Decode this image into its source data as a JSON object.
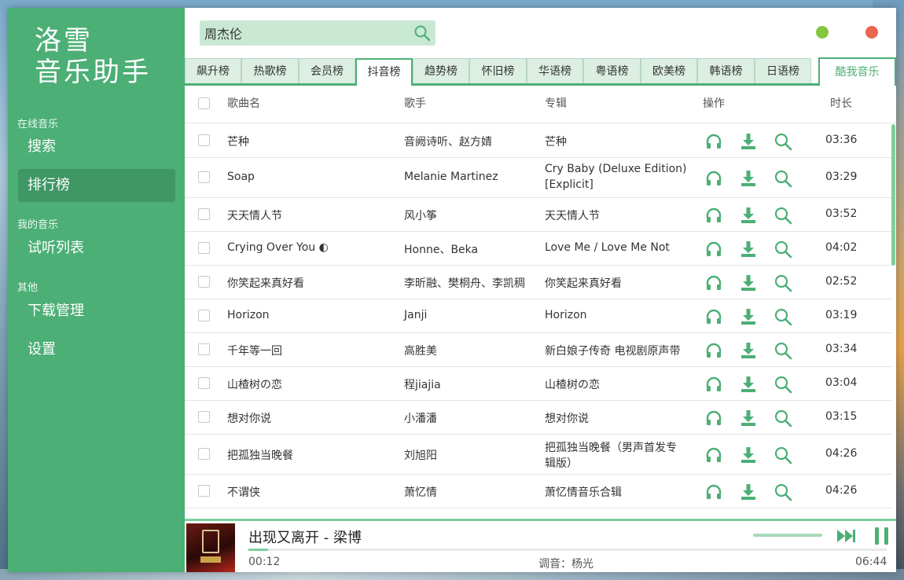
{
  "app": {
    "logo_line1": "洛雪",
    "logo_line2": "音乐助手"
  },
  "sidebar": {
    "sections": [
      {
        "label": "在线音乐",
        "items": [
          {
            "label": "搜索"
          },
          {
            "label": "排行榜",
            "active": true
          }
        ]
      },
      {
        "label": "我的音乐",
        "items": [
          {
            "label": "试听列表"
          }
        ]
      },
      {
        "label": "其他",
        "items": [
          {
            "label": "下载管理"
          },
          {
            "label": "设置"
          }
        ]
      }
    ]
  },
  "search": {
    "value": "周杰伦",
    "icon": "search-icon"
  },
  "window_controls": {
    "minimize_color": "#85c63f",
    "close_color": "#e9674f"
  },
  "tabs": [
    {
      "label": "飙升榜"
    },
    {
      "label": "热歌榜"
    },
    {
      "label": "会员榜"
    },
    {
      "label": "抖音榜",
      "active": true
    },
    {
      "label": "趋势榜"
    },
    {
      "label": "怀旧榜"
    },
    {
      "label": "华语榜"
    },
    {
      "label": "粤语榜"
    },
    {
      "label": "欧美榜"
    },
    {
      "label": "韩语榜"
    },
    {
      "label": "日语榜"
    }
  ],
  "source_tab": {
    "label": "酷我音乐"
  },
  "table": {
    "headers": {
      "name": "歌曲名",
      "artist": "歌手",
      "album": "专辑",
      "ops": "操作",
      "duration": "时长"
    },
    "rows": [
      {
        "name": "芒种",
        "artist": "音阙诗听、赵方婧",
        "album": "芒种",
        "album2": "",
        "duration": "03:36"
      },
      {
        "name": "Soap",
        "artist": "Melanie Martinez",
        "album": "Cry Baby (Deluxe Edition)",
        "album2": "[Explicit]",
        "duration": "03:29"
      },
      {
        "name": "天天情人节",
        "artist": "风小筝",
        "album": "天天情人节",
        "album2": "",
        "duration": "03:52"
      },
      {
        "name": "Crying Over You ◐",
        "artist": "Honne、Beka",
        "album": "Love Me / Love Me Not",
        "album2": "",
        "duration": "04:02"
      },
      {
        "name": "你笑起来真好看",
        "artist": "李昕融、樊桐舟、李凯稠",
        "album": "你笑起来真好看",
        "album2": "",
        "duration": "02:52"
      },
      {
        "name": "Horizon",
        "artist": "Janji",
        "album": "Horizon",
        "album2": "",
        "duration": "03:19"
      },
      {
        "name": "千年等一回",
        "artist": "高胜美",
        "album": "新白娘子传奇 电视剧原声带",
        "album2": "",
        "duration": "03:34"
      },
      {
        "name": "山楂树の恋",
        "artist": "程jiajia",
        "album": "山楂树の恋",
        "album2": "",
        "duration": "03:04"
      },
      {
        "name": "想对你说",
        "artist": "小潘潘",
        "album": "想对你说",
        "album2": "",
        "duration": "03:15"
      },
      {
        "name": "把孤独当晚餐",
        "artist": "刘旭阳",
        "album": "把孤独当晚餐（男声首发专",
        "album2": "辑版）",
        "duration": "04:26"
      },
      {
        "name": "不谓侠",
        "artist": "萧忆情",
        "album": "萧忆情音乐合辑",
        "album2": "",
        "duration": "04:26"
      }
    ]
  },
  "player": {
    "title": "出现又离开 - 梁博",
    "current_time": "00:12",
    "quality": "调音：杨光",
    "total_time": "06:44",
    "progress": 0.031,
    "accent": "#4caf76"
  }
}
